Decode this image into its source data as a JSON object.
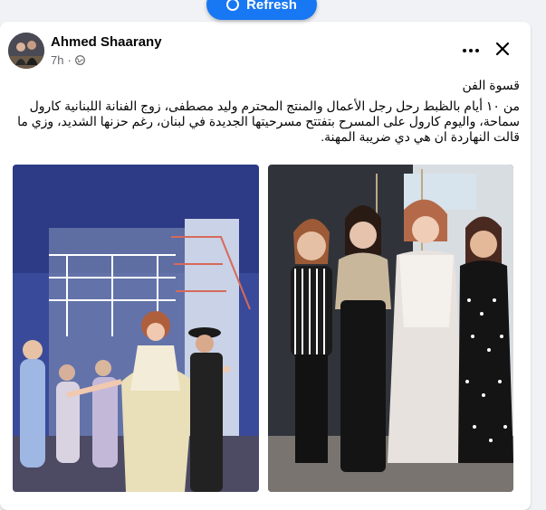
{
  "refresh": {
    "label": "Refresh"
  },
  "post": {
    "author": "Ahmed Shaarany",
    "time": "7h",
    "privacy_icon": "globe-icon",
    "title": "قسوة الفن",
    "body": "من ١٠ أيام بالظبط رحل رجل الأعمال والمنتج المحترم وليد مصطفى، زوج الفنانة اللبنانية كارول سماحة، واليوم كارول على المسرح بتفتتح مسرحيتها الجديدة في لبنان، رغم حزنها الشديد، وزي ما قالت النهاردة ان هي دي ضريبة المهنة."
  },
  "icons": {
    "more": "more-horizontal-icon",
    "close": "close-icon"
  },
  "colors": {
    "accent": "#1877f2",
    "background": "#f0f2f5",
    "card": "#ffffff",
    "text": "#050505",
    "secondary_text": "#65676b"
  }
}
